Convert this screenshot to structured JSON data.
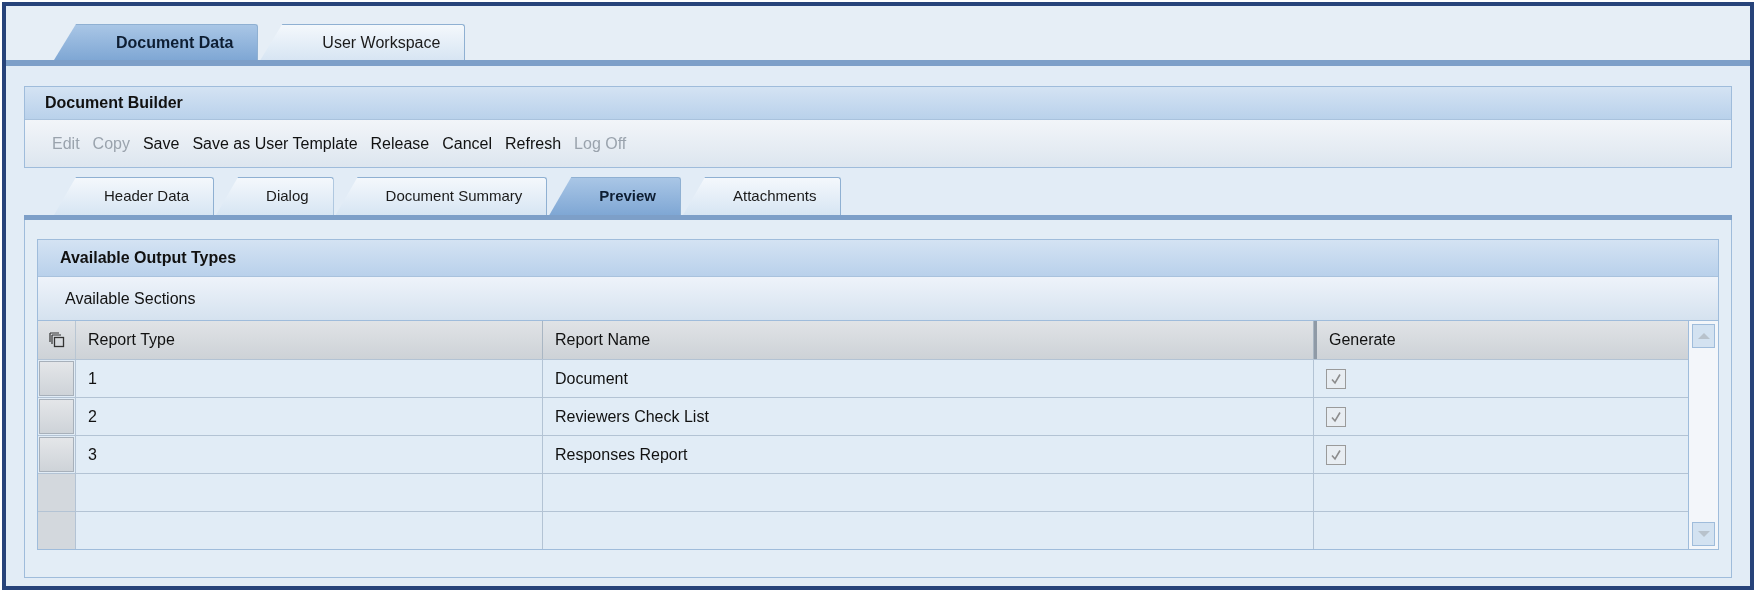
{
  "top_tabs": [
    {
      "label": "Document Data",
      "selected": true
    },
    {
      "label": "User Workspace",
      "selected": false
    }
  ],
  "builder": {
    "title": "Document Builder",
    "toolbar": [
      {
        "label": "Edit",
        "disabled": true
      },
      {
        "label": "Copy",
        "disabled": true
      },
      {
        "label": "Save",
        "disabled": false
      },
      {
        "label": "Save as User Template",
        "disabled": false
      },
      {
        "label": "Release",
        "disabled": false
      },
      {
        "label": "Cancel",
        "disabled": false
      },
      {
        "label": "Refresh",
        "disabled": false
      },
      {
        "label": "Log Off",
        "disabled": true
      }
    ],
    "tabs": [
      {
        "label": "Header Data",
        "selected": false
      },
      {
        "label": "Dialog",
        "selected": false
      },
      {
        "label": "Document Summary",
        "selected": false
      },
      {
        "label": "Preview",
        "selected": true
      },
      {
        "label": "Attachments",
        "selected": false
      }
    ]
  },
  "output_types": {
    "title": "Available Output Types",
    "subtitle": "Available Sections",
    "table": {
      "columns": [
        "Report Type",
        "Report Name",
        "Generate"
      ],
      "rows": [
        {
          "kind": "data",
          "report_type": "1",
          "report_name": "Document",
          "generate": {
            "checked": true,
            "disabled": true
          }
        },
        {
          "kind": "data",
          "report_type": "2",
          "report_name": "Reviewers Check List",
          "generate": {
            "checked": true,
            "disabled": true
          }
        },
        {
          "kind": "data",
          "report_type": "3",
          "report_name": "Responses Report",
          "generate": {
            "checked": true,
            "disabled": true
          }
        },
        {
          "kind": "blank"
        },
        {
          "kind": "blank"
        }
      ]
    }
  }
}
